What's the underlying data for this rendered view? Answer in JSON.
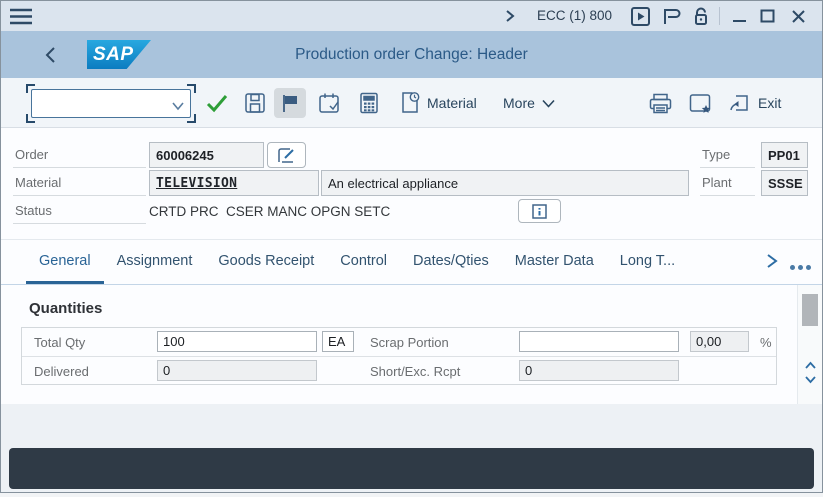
{
  "system_bar": {
    "session": "ECC (1) 800"
  },
  "title_bar": {
    "logo_text": "SAP",
    "title": "Production order Change: Header"
  },
  "toolbar": {
    "command_value": "",
    "material": "Material",
    "more": "More",
    "exit": "Exit"
  },
  "header_form": {
    "order_label": "Order",
    "order_value": "60006245",
    "type_label": "Type",
    "type_value": "PP01",
    "material_label": "Material",
    "material_value": "TELEVISION",
    "material_description": "An electrical appliance",
    "plant_label": "Plant",
    "plant_value": "SSSE",
    "status_label": "Status",
    "status_value": "CRTD PRC  CSER MANC OPGN SETC"
  },
  "tabs": {
    "items": [
      {
        "label": "General",
        "active": true
      },
      {
        "label": "Assignment",
        "active": false
      },
      {
        "label": "Goods Receipt",
        "active": false
      },
      {
        "label": "Control",
        "active": false
      },
      {
        "label": "Dates/Qties",
        "active": false
      },
      {
        "label": "Master Data",
        "active": false
      },
      {
        "label": "Long T...",
        "active": false
      }
    ]
  },
  "quantities": {
    "title": "Quantities",
    "total_qty_label": "Total Qty",
    "total_qty_value": "100",
    "total_qty_unit": "EA",
    "scrap_label": "Scrap Portion",
    "scrap_value": "",
    "scrap_readonly_value": "0,00",
    "scrap_unit": "%",
    "delivered_label": "Delivered",
    "delivered_value": "0",
    "short_exc_label": "Short/Exc. Rcpt",
    "short_exc_value": "0"
  },
  "icons": {
    "menu": "≡",
    "chevron-right": "›",
    "play-window": "▶",
    "sessions-flag": "⚑",
    "unlock": "🔓",
    "minimize": "—",
    "maximize": "□",
    "close": "✕",
    "back": "‹",
    "dropdown": "⌄",
    "confirm-check": "✓",
    "save": "💾",
    "flag": "⚑",
    "calendar-check": "📅",
    "calculator": "🖩",
    "material-doc-clock": "🕓",
    "print": "🖶",
    "new-session-star": "✦",
    "shortcut-arrow": "↵",
    "edit-pencil": "✎",
    "info": "ℹ",
    "tab-overflow": "•••",
    "scroll-up": "⌃",
    "scroll-down": "⌄"
  },
  "colors": {
    "sysbar_bg": "#dbe4ee",
    "titlebar_bg": "#a9c3dc",
    "toolbar_bg": "#f1f5f9",
    "active_tab": "#2a6496",
    "icon_blue": "#41658a",
    "check_green": "#2e9e38",
    "statusbar_bg": "#2f3a46",
    "readonly_field_bg": "#f0f2f4"
  }
}
